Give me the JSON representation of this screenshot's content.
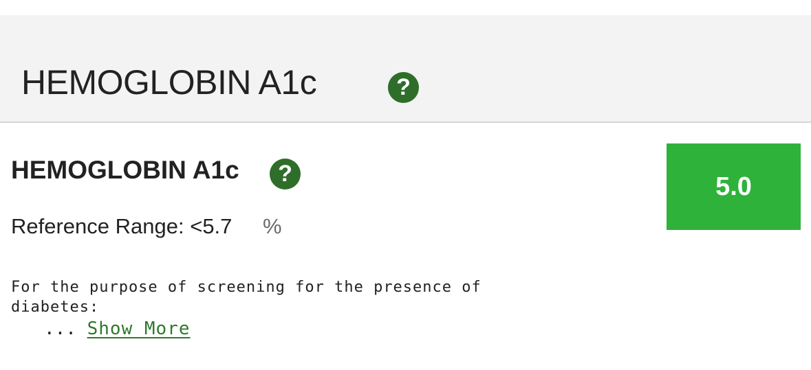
{
  "header": {
    "title": "HEMOGLOBIN A1c",
    "help_icon": "question-mark-icon",
    "help_glyph": "?"
  },
  "test": {
    "name": "HEMOGLOBIN A1c",
    "help_icon": "question-mark-icon",
    "help_glyph": "?",
    "reference_range": "Reference Range: <5.7",
    "unit": "%",
    "result_value": "5.0",
    "result_color": "#2fb23a",
    "comment_line1": "For the purpose of screening for the presence of",
    "comment_line2": "diabetes:",
    "ellipsis": "...",
    "show_more_label": "Show More"
  },
  "colors": {
    "header_bg": "#f3f3f3",
    "help_icon_bg": "#2e6e2a",
    "link": "#2e7a2a"
  }
}
